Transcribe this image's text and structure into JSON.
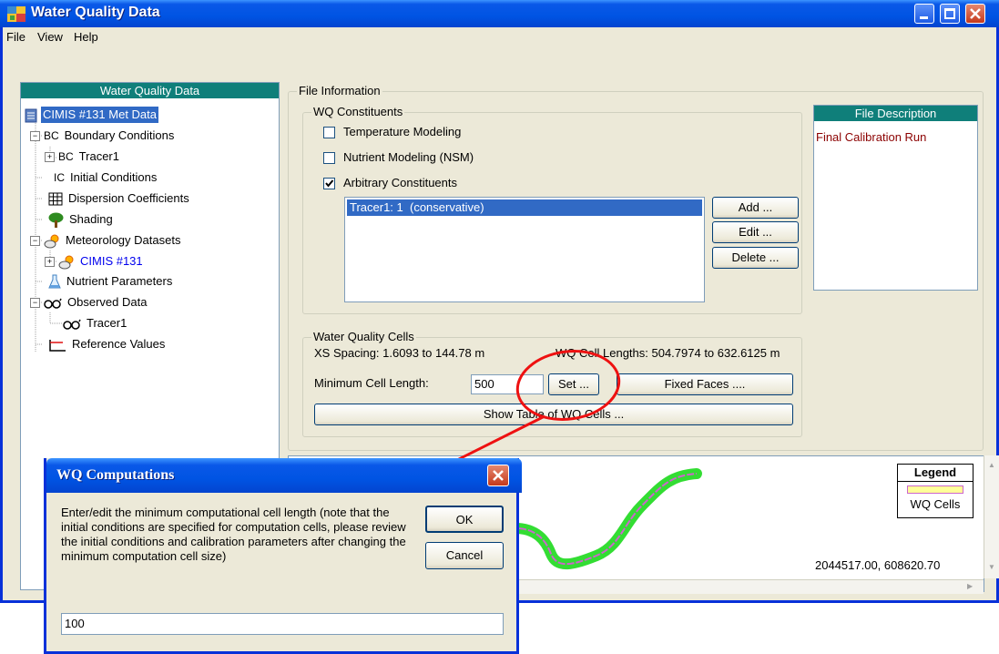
{
  "window": {
    "title": "Water Quality Data",
    "menu": [
      "File",
      "View",
      "Help"
    ]
  },
  "tree": {
    "header": "Water Quality Data",
    "nodes": [
      {
        "label": "CIMIS #131 Met Data",
        "prefix": "",
        "icon": "document-icon"
      },
      {
        "label": "Boundary Conditions",
        "prefix": "BC",
        "icon": "bc-icon"
      },
      {
        "label": "Tracer1",
        "prefix": "BC",
        "icon": "bc-icon"
      },
      {
        "label": "Initial Conditions",
        "prefix": "IC",
        "icon": "ic-icon"
      },
      {
        "label": "Dispersion Coefficients",
        "prefix": "",
        "icon": "grid-icon"
      },
      {
        "label": "Shading",
        "prefix": "",
        "icon": "tree-icon"
      },
      {
        "label": "Meteorology Datasets",
        "prefix": "",
        "icon": "weather-icon"
      },
      {
        "label": "CIMIS #131",
        "prefix": "",
        "icon": "weather-icon"
      },
      {
        "label": "Nutrient Parameters",
        "prefix": "",
        "icon": "flask-icon"
      },
      {
        "label": "Observed Data",
        "prefix": "",
        "icon": "glasses-icon"
      },
      {
        "label": "Tracer1",
        "prefix": "",
        "icon": "glasses-icon"
      },
      {
        "label": "Reference Values",
        "prefix": "",
        "icon": "axis-icon"
      }
    ]
  },
  "file_info": {
    "title": "File Information",
    "constituents": {
      "title": "WQ Constituents",
      "checkboxes": [
        {
          "label": "Temperature Modeling",
          "checked": false
        },
        {
          "label": "Nutrient Modeling (NSM)",
          "checked": false
        },
        {
          "label": "Arbitrary Constituents",
          "checked": true
        }
      ],
      "list_items": [
        "Tracer1: 1  (conservative)"
      ],
      "add_label": "Add ...",
      "edit_label": "Edit ...",
      "delete_label": "Delete ..."
    },
    "description": {
      "header": "File Description",
      "text": "Final Calibration Run"
    },
    "cells": {
      "title": "Water Quality Cells",
      "xs_spacing": "XS Spacing: 1.6093 to 144.78 m",
      "cell_lengths": "WQ Cell Lengths: 504.7974 to 632.6125 m",
      "min_label": "Minimum Cell Length:",
      "min_value": "500",
      "set_label": "Set ...",
      "fixed_label": "Fixed Faces ....",
      "show_label": "Show Table of WQ Cells ..."
    }
  },
  "map": {
    "legend_title": "Legend",
    "legend_item": "WQ Cells",
    "coordinates": "2044517.00, 608620.70"
  },
  "dialog": {
    "title": "WQ Computations",
    "message": "Enter/edit the minimum computational cell length (note that the initial conditions are specified for computation cells, please review the initial conditions and calibration parameters after changing the minimum computation cell size)",
    "ok_label": "OK",
    "cancel_label": "Cancel",
    "input_value": "100"
  },
  "colors": {
    "title_blue": "#0054e3",
    "tree_header": "#0f7f7a",
    "description_text": "#8b0000",
    "river_green": "#33dd33",
    "wq_cells": "#cc66cc",
    "annotation_red": "#ee1111"
  }
}
